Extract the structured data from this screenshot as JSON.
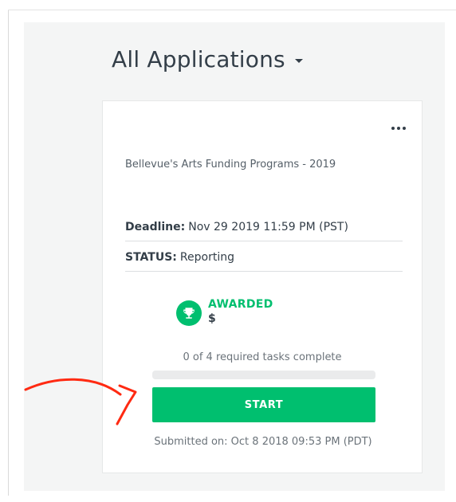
{
  "header": {
    "title": "All Applications"
  },
  "card": {
    "program_name": "Bellevue's Arts Funding Programs - 2019",
    "deadline_label": "Deadline:",
    "deadline_value": "Nov 29 2019 11:59 PM (PST)",
    "status_label": "STATUS:",
    "status_value": "Reporting",
    "award_label": "AWARDED",
    "award_amount": "$",
    "tasks_text": "0 of 4 required tasks complete",
    "tasks_progress_fraction": 0,
    "start_label": "START",
    "submitted_text": "Submitted on: Oct 8 2018 09:53 PM (PDT)"
  },
  "icons": {
    "title_dropdown": "caret-down-icon",
    "more": "more-options-icon",
    "award": "trophy-icon"
  },
  "colors": {
    "accent": "#00bf6f",
    "text": "#333e48",
    "annotation": "#ff2a12"
  }
}
